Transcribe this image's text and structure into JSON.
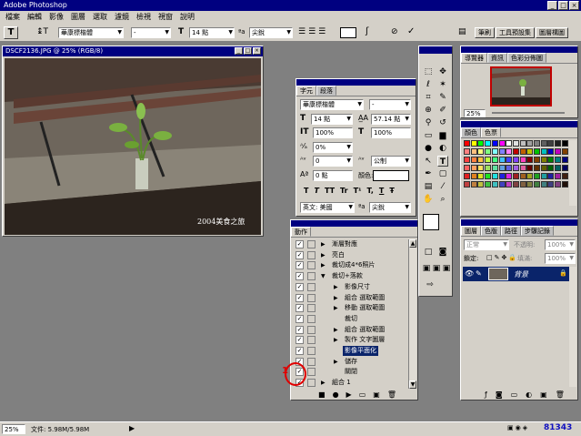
{
  "app": {
    "title": "Adobe Photoshop"
  },
  "menu": [
    "檔案",
    "編輯",
    "影像",
    "圖層",
    "選取",
    "濾鏡",
    "檢視",
    "視窗",
    "說明"
  ],
  "options": {
    "font_family": "華康標楷體",
    "font_style": "-",
    "font_size": "14 點",
    "antialias": "尖銳",
    "tabs": [
      "筆刷",
      "工具預設集",
      "圖層構圖"
    ]
  },
  "document": {
    "title": "DSCF2136.JPG @ 25% (RGB/8)",
    "watermark": "2004美食之旅"
  },
  "navigator": {
    "tabs": [
      "導覽器",
      "資訊",
      "色彩分佈圖"
    ],
    "zoom": "25%"
  },
  "swatches": {
    "tabs": [
      "顏色",
      "色票"
    ]
  },
  "layers": {
    "tabs": [
      "圖層",
      "色版",
      "路徑",
      "步驟記錄"
    ],
    "blend": "正常",
    "opacity_label": "不透明:",
    "opacity": "100%",
    "lock_label": "鎖定:",
    "fill_label": "填滿:",
    "fill": "100%",
    "layer_name": "背景"
  },
  "character": {
    "tabs": [
      "字元",
      "段落"
    ],
    "font": "華康標楷體",
    "style": "-",
    "size": "14 點",
    "leading": "57.14 點",
    "scale_v": "100%",
    "scale_h": "100%",
    "baseline": "0%",
    "kerning": "0",
    "tracking": "公制",
    "shift": "0 點",
    "color_label": "顏色:",
    "language": "英文: 美國",
    "antialias": "尖銳",
    "style_buttons": [
      "T",
      "T",
      "TT",
      "Tr",
      "T¹",
      "T,",
      "T",
      "Ŧ"
    ]
  },
  "actions": {
    "tab": "動作",
    "items": [
      {
        "label": "漸層對應",
        "indent": 0,
        "checked": true,
        "expanded": false,
        "selected": false
      },
      {
        "label": "亮白",
        "indent": 0,
        "checked": true,
        "expanded": false,
        "selected": false
      },
      {
        "label": "裁切成4*6照片",
        "indent": 0,
        "checked": true,
        "expanded": false,
        "selected": false
      },
      {
        "label": "裁切+落款",
        "indent": 0,
        "checked": true,
        "expanded": true,
        "selected": false
      },
      {
        "label": "影像尺寸",
        "indent": 1,
        "checked": true,
        "expanded": false,
        "selected": false
      },
      {
        "label": "組合 選取範圍",
        "indent": 1,
        "checked": true,
        "expanded": false,
        "selected": false
      },
      {
        "label": "移動 選取範圍",
        "indent": 1,
        "checked": true,
        "expanded": false,
        "selected": false
      },
      {
        "label": "裁切",
        "indent": 1,
        "checked": true,
        "expanded": false,
        "selected": false
      },
      {
        "label": "組合 選取範圍",
        "indent": 1,
        "checked": true,
        "expanded": false,
        "selected": false
      },
      {
        "label": "製作 文字圖層",
        "indent": 1,
        "checked": true,
        "expanded": false,
        "selected": false
      },
      {
        "label": "影像平面化",
        "indent": 1,
        "checked": true,
        "expanded": false,
        "selected": true
      },
      {
        "label": "儲存",
        "indent": 1,
        "checked": true,
        "expanded": false,
        "selected": false
      },
      {
        "label": "關閉",
        "indent": 1,
        "checked": true,
        "expanded": false,
        "selected": false
      },
      {
        "label": "組合 1",
        "indent": 0,
        "checked": true,
        "expanded": false,
        "selected": false
      }
    ],
    "annotation": "1"
  },
  "status": {
    "zoom": "25%",
    "doc_size": "文件: 5.98M/5.98M"
  },
  "watermark_corner": "81343",
  "colors": {
    "title_blue": "#000080",
    "selection": "#0a246a",
    "annotation_red": "#e00000"
  }
}
